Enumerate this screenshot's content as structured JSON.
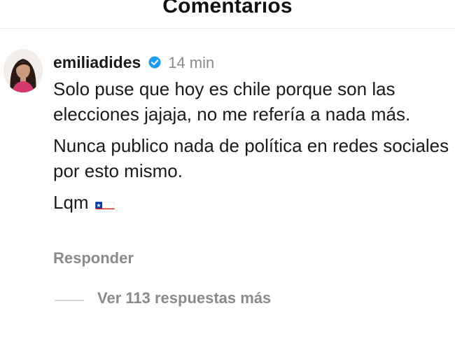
{
  "header": {
    "title": "Comentarios"
  },
  "comment": {
    "username": "emiliadides",
    "verified": true,
    "time": "14 min",
    "paragraphs": [
      "Solo puse que hoy es chile porque son las elecciones jajaja, no me refería a nada más.",
      "Nunca publico nada de política en redes sociales por esto mismo.",
      "Lqm"
    ],
    "emoji": "chile-flag-icon",
    "reply_label": "Responder",
    "more_replies_label": "Ver 113 respuestas más"
  },
  "colors": {
    "text": "#1a1a1a",
    "muted": "#8a8a8a",
    "verified_blue": "#1d9bf0",
    "flag_red": "#d52b1e",
    "flag_blue": "#0039a6"
  }
}
